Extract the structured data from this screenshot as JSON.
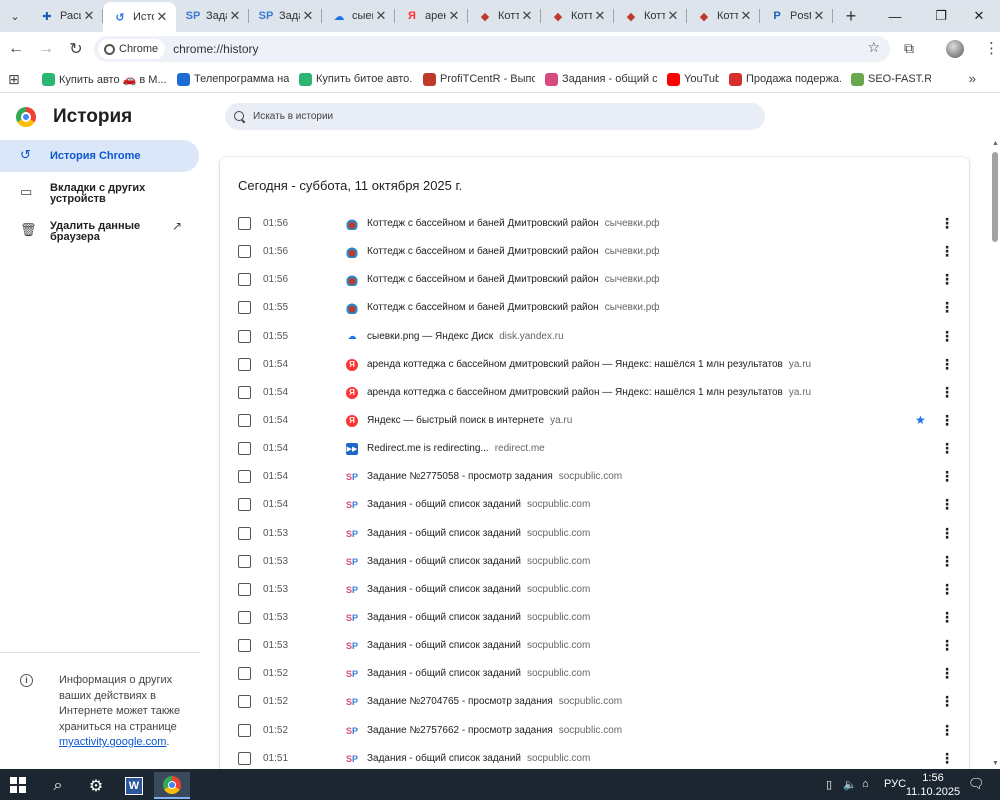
{
  "tabs": [
    {
      "label": "Расш",
      "icon": "puzzle-icon",
      "active": false
    },
    {
      "label": "Исто",
      "icon": "history-icon",
      "active": true
    },
    {
      "label": "Зада",
      "icon": "sp-icon",
      "active": false
    },
    {
      "label": "Зада",
      "icon": "sp-icon",
      "active": false
    },
    {
      "label": "сыев",
      "icon": "disk-icon",
      "active": false
    },
    {
      "label": "арен",
      "icon": "yandex-icon",
      "active": false
    },
    {
      "label": "Котт",
      "icon": "cottage-icon",
      "active": false
    },
    {
      "label": "Котт",
      "icon": "cottage-icon",
      "active": false
    },
    {
      "label": "Котт",
      "icon": "cottage-icon",
      "active": false
    },
    {
      "label": "Котт",
      "icon": "cottage-icon",
      "active": false
    },
    {
      "label": "Post",
      "icon": "post-icon",
      "active": false
    }
  ],
  "toolbar": {
    "chip_label": "Chrome",
    "url": "chrome://history"
  },
  "bookmarks": [
    {
      "label": "Купить авто 🚗 в М...",
      "icon": "drom-icon",
      "color": "#2bb673"
    },
    {
      "label": "Телепрограмма на...",
      "icon": "tv-icon",
      "color": "#1e6bd6"
    },
    {
      "label": "Купить битое авто...",
      "icon": "drom-icon",
      "color": "#2bb673"
    },
    {
      "label": "ProfiTCentR - Выпо...",
      "icon": "chart-icon",
      "color": "#c0392b"
    },
    {
      "label": "Задания - общий с...",
      "icon": "sp-icon",
      "color": "#d74b7e"
    },
    {
      "label": "YouTube",
      "icon": "youtube-icon",
      "color": "#ff0000"
    },
    {
      "label": "Продажа подержа...",
      "icon": "drom-red-icon",
      "color": "#d62d2d"
    },
    {
      "label": "SEO-FAST.RU",
      "icon": "seofast-icon",
      "color": "#6aa84f"
    }
  ],
  "page": {
    "title": "История",
    "search_placeholder": "Искать в истории"
  },
  "sidebar": {
    "items": [
      {
        "label": "История Chrome"
      },
      {
        "label1": "Вкладки с других",
        "label2": "устройств"
      },
      {
        "label1": "Удалить данные",
        "label2": "браузера"
      }
    ],
    "info_text": "Информация о других ваших действиях в Интернете может также храниться на странице",
    "info_link": "myactivity.google.com",
    "info_end": "."
  },
  "history": {
    "date_header": "Сегодня - суббота, 11 октября 2025 г.",
    "entries": [
      {
        "time": "01:56",
        "title": "Коттедж с бассейном и баней Дмитровский район",
        "domain": "сычевки.рф",
        "favicon": "cottage-icon",
        "starred": false
      },
      {
        "time": "01:56",
        "title": "Коттедж с бассейном и баней Дмитровский район",
        "domain": "сычевки.рф",
        "favicon": "cottage-icon",
        "starred": false
      },
      {
        "time": "01:56",
        "title": "Коттедж с бассейном и баней Дмитровский район",
        "domain": "сычевки.рф",
        "favicon": "cottage-icon",
        "starred": false
      },
      {
        "time": "01:55",
        "title": "Коттедж с бассейном и баней Дмитровский район",
        "domain": "сычевки.рф",
        "favicon": "cottage-icon",
        "starred": false
      },
      {
        "time": "01:55",
        "title": "сыевки.png — Яндекс Диск",
        "domain": "disk.yandex.ru",
        "favicon": "disk-icon",
        "starred": false
      },
      {
        "time": "01:54",
        "title": "аренда коттеджа с бассейном дмитровский район — Яндекс: нашёлся 1 млн результатов",
        "domain": "ya.ru",
        "favicon": "yandex-icon",
        "starred": false
      },
      {
        "time": "01:54",
        "title": "аренда коттеджа с бассейном дмитровский район — Яндекс: нашёлся 1 млн результатов",
        "domain": "ya.ru",
        "favicon": "yandex-icon",
        "starred": false
      },
      {
        "time": "01:54",
        "title": "Яндекс — быстрый поиск в интернете",
        "domain": "ya.ru",
        "favicon": "yandex-icon",
        "starred": true
      },
      {
        "time": "01:54",
        "title": "Redirect.me is redirecting...",
        "domain": "redirect.me",
        "favicon": "redirect-icon",
        "starred": false
      },
      {
        "time": "01:54",
        "title": "Задание №2775058 - просмотр задания",
        "domain": "socpublic.com",
        "favicon": "sp-icon",
        "starred": false
      },
      {
        "time": "01:54",
        "title": "Задания - общий список заданий",
        "domain": "socpublic.com",
        "favicon": "sp-icon",
        "starred": false
      },
      {
        "time": "01:53",
        "title": "Задания - общий список заданий",
        "domain": "socpublic.com",
        "favicon": "sp-icon",
        "starred": false
      },
      {
        "time": "01:53",
        "title": "Задания - общий список заданий",
        "domain": "socpublic.com",
        "favicon": "sp-icon",
        "starred": false
      },
      {
        "time": "01:53",
        "title": "Задания - общий список заданий",
        "domain": "socpublic.com",
        "favicon": "sp-icon",
        "starred": false
      },
      {
        "time": "01:53",
        "title": "Задания - общий список заданий",
        "domain": "socpublic.com",
        "favicon": "sp-icon",
        "starred": false
      },
      {
        "time": "01:53",
        "title": "Задания - общий список заданий",
        "domain": "socpublic.com",
        "favicon": "sp-icon",
        "starred": false
      },
      {
        "time": "01:52",
        "title": "Задания - общий список заданий",
        "domain": "socpublic.com",
        "favicon": "sp-icon",
        "starred": false
      },
      {
        "time": "01:52",
        "title": "Задание №2704765 - просмотр задания",
        "domain": "socpublic.com",
        "favicon": "sp-icon",
        "starred": false
      },
      {
        "time": "01:52",
        "title": "Задание №2757662 - просмотр задания",
        "domain": "socpublic.com",
        "favicon": "sp-icon",
        "starred": false
      },
      {
        "time": "01:51",
        "title": "Задания - общий список заданий",
        "domain": "socpublic.com",
        "favicon": "sp-icon",
        "starred": false
      }
    ]
  },
  "taskbar": {
    "lang": "РУС",
    "time": "1:56",
    "date": "11.10.2025"
  }
}
